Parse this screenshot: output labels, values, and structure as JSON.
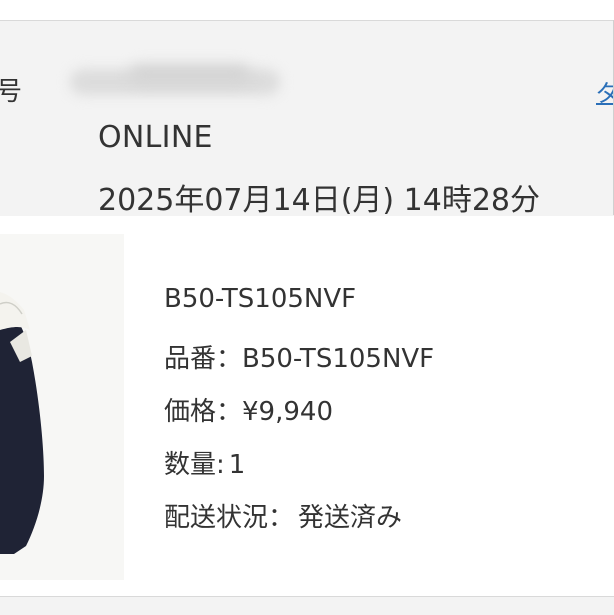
{
  "order": {
    "label": "号",
    "link_text": "ダ",
    "store": "ONLINE",
    "datetime": "2025年07月14日(月) 14時28分"
  },
  "item": {
    "name": "B50-TS105NVF",
    "sku_label": "品番：",
    "sku_value": "B50-TS105NVF",
    "price_label": "価格：",
    "price_value": "¥9,940",
    "qty_label": "数量:",
    "qty_value": "1",
    "status_label": "配送状況：",
    "status_value": "発送済み",
    "image_icon": "product-photo-swimsuit",
    "colors": {
      "navy": "#1f2335",
      "white": "#f4f3ee"
    }
  },
  "colors": {
    "link": "#2a6fb8",
    "panel": "#f3f3f3",
    "text": "#333333"
  }
}
